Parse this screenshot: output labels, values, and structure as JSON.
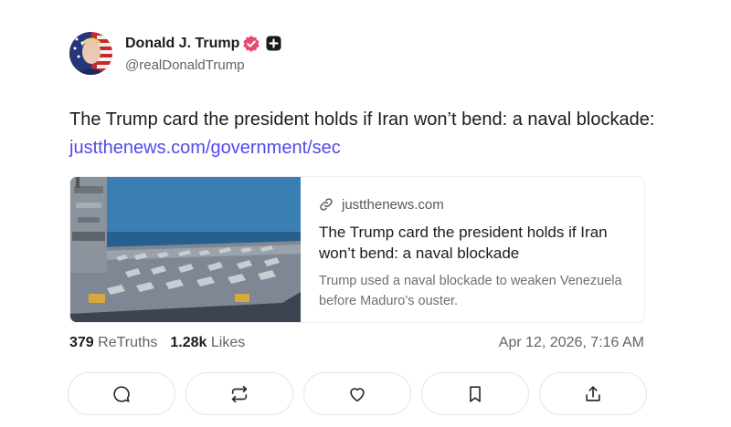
{
  "post": {
    "author_name": "Donald J. Trump",
    "handle": "@realDonaldTrump",
    "text": "The Trump card the president holds if Iran won’t bend: a naval blockade: ",
    "link_text": "justthenews.com/government/sec"
  },
  "card": {
    "domain": "justthenews.com",
    "title": "The Trump card the president holds if Iran won’t bend: a naval blockade",
    "description": "Trump used a naval blockade to weaken Venezuela before Maduro’s ouster."
  },
  "stats": {
    "retruths_count": "379",
    "retruths_label": "ReTruths",
    "likes_count": "1.28k",
    "likes_label": "Likes",
    "timestamp": "Apr 12, 2026, 7:16 AM"
  },
  "actions": [
    "reply-icon",
    "retruth-icon",
    "like-icon",
    "bookmark-icon",
    "share-icon"
  ],
  "colors": {
    "link": "#5448ee",
    "verified": "#e84a6f",
    "border": "#e3e5ea"
  }
}
